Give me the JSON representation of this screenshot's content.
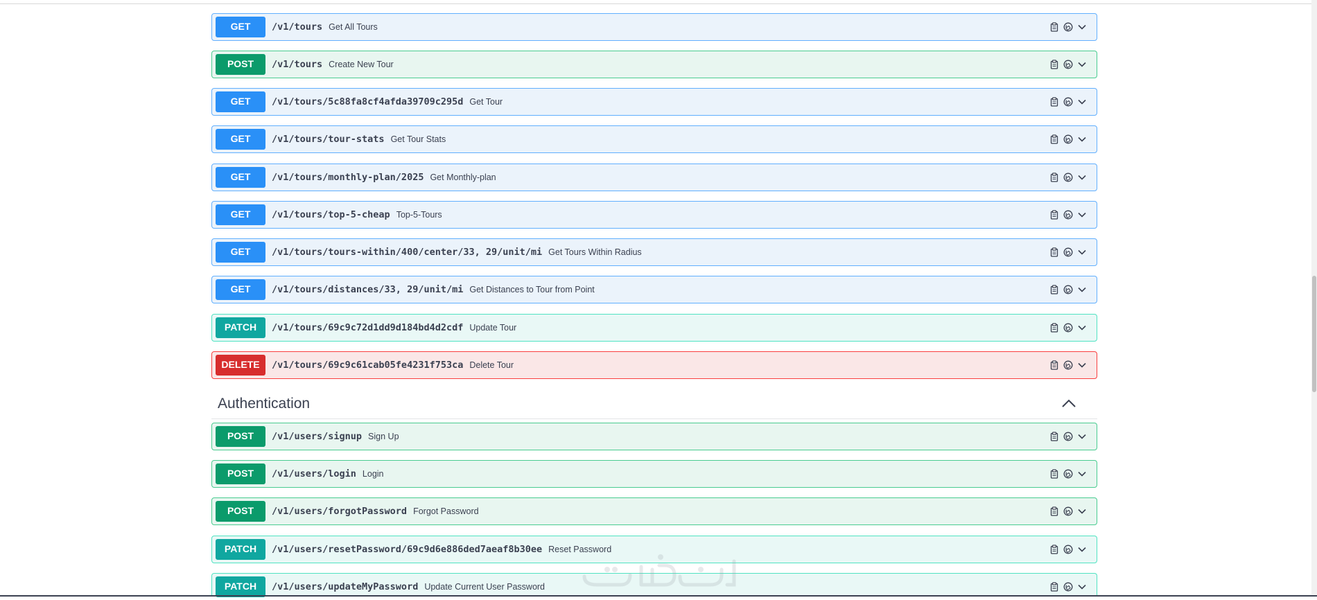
{
  "colors": {
    "get": "#2a90f7",
    "post": "#0b9b6b",
    "patch": "#10a7a0",
    "delete": "#d72d2d",
    "text": "#3b4151"
  },
  "icons": [
    "copy-icon",
    "lock-icon",
    "chevron-down-icon"
  ],
  "tours_operations": [
    {
      "method": "GET",
      "path": "/v1/tours",
      "summary": "Get All Tours"
    },
    {
      "method": "POST",
      "path": "/v1/tours",
      "summary": "Create New Tour"
    },
    {
      "method": "GET",
      "path": "/v1/tours/5c88fa8cf4afda39709c295d",
      "summary": "Get Tour"
    },
    {
      "method": "GET",
      "path": "/v1/tours/tour-stats",
      "summary": "Get Tour Stats"
    },
    {
      "method": "GET",
      "path": "/v1/tours/monthly-plan/2025",
      "summary": "Get Monthly-plan"
    },
    {
      "method": "GET",
      "path": "/v1/tours/top-5-cheap",
      "summary": "Top-5-Tours"
    },
    {
      "method": "GET",
      "path": "/v1/tours/tours-within/400/center/33, 29/unit/mi",
      "summary": "Get Tours Within Radius"
    },
    {
      "method": "GET",
      "path": "/v1/tours/distances/33, 29/unit/mi",
      "summary": "Get Distances to Tour from Point"
    },
    {
      "method": "PATCH",
      "path": "/v1/tours/69c9c72d1dd9d184bd4d2cdf",
      "summary": "Update Tour"
    },
    {
      "method": "DELETE",
      "path": "/v1/tours/69c9c61cab05fe4231f753ca",
      "summary": "Delete Tour"
    }
  ],
  "authentication": {
    "title": "Authentication",
    "operations": [
      {
        "method": "POST",
        "path": "/v1/users/signup",
        "summary": "Sign Up"
      },
      {
        "method": "POST",
        "path": "/v1/users/login",
        "summary": "Login"
      },
      {
        "method": "POST",
        "path": "/v1/users/forgotPassword",
        "summary": "Forgot Password"
      },
      {
        "method": "PATCH",
        "path": "/v1/users/resetPassword/69c9d6e886ded7aeaf8b30ee",
        "summary": "Reset Password"
      },
      {
        "method": "PATCH",
        "path": "/v1/users/updateMyPassword",
        "summary": "Update Current User Password"
      }
    ]
  }
}
